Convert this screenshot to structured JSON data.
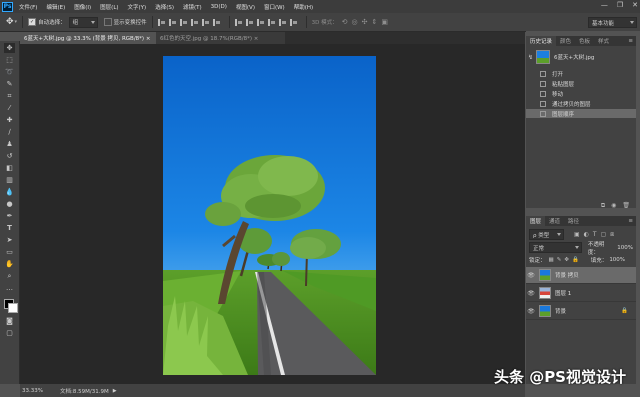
{
  "app": {
    "logo": "Ps"
  },
  "menu": [
    "文件(F)",
    "编辑(E)",
    "图像(I)",
    "图层(L)",
    "文字(Y)",
    "选择(S)",
    "滤镜(T)",
    "3D(D)",
    "视图(V)",
    "窗口(W)",
    "帮助(H)"
  ],
  "window_controls": {
    "minimize": "—",
    "restore": "❐",
    "close": "✕"
  },
  "options": {
    "auto_select_label": "自动选择：",
    "auto_select_value": "组",
    "show_transform_label": "显示变换控件",
    "mode_3d_label": "3D 模式：",
    "workspace": "基本功能"
  },
  "tabs": [
    {
      "label": "6蓝天+大树.jpg @ 33.3% (背景 拷贝, RGB/8*) ×",
      "active": true
    },
    {
      "label": "6红色的天空.jpg @ 18.7%(RGB/8*) ×",
      "active": false
    }
  ],
  "status": {
    "zoom": "33.33%",
    "doc": "文档:8.59M/31.9M",
    "arrow": "▶"
  },
  "history_panel": {
    "tabs": [
      "历史记录",
      "颜色",
      "色板",
      "样式"
    ],
    "snapshot": "6蓝天+大树.jpg",
    "items": [
      "打开",
      "粘贴图层",
      "移动",
      "通过拷贝的图层",
      "图层顺序"
    ]
  },
  "layers_panel": {
    "tabs": [
      "图层",
      "通道",
      "路径"
    ],
    "filter_label": "ρ 类型",
    "blend_mode": "正常",
    "opacity_label": "不透明度：",
    "opacity_value": "100%",
    "lock_label": "锁定：",
    "fill_label": "填充：",
    "fill_value": "100%",
    "layers": [
      {
        "name": "背景 拷贝",
        "selected": true
      },
      {
        "name": "图层 1",
        "selected": false
      },
      {
        "name": "背景",
        "selected": false
      }
    ]
  },
  "watermark": "头条 @PS视觉设计"
}
